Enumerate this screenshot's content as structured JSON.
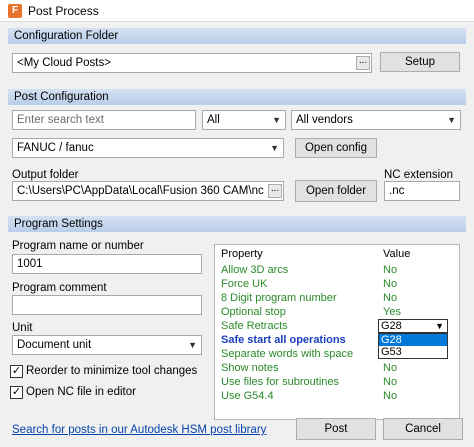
{
  "window": {
    "title": "Post Process"
  },
  "config_folder": {
    "section": "Configuration Folder",
    "value": "<My Cloud Posts>",
    "browse": "...",
    "setup": "Setup"
  },
  "post_config": {
    "section": "Post Configuration",
    "search_placeholder": "Enter search text",
    "filter_all": "All",
    "vendor": "All vendors",
    "post": "FANUC / fanuc",
    "open_config": "Open config",
    "output_folder_label": "Output folder",
    "output_folder": "C:\\Users\\PC\\AppData\\Local\\Fusion 360 CAM\\nc",
    "browse": "...",
    "open_folder": "Open folder",
    "nc_ext_label": "NC extension",
    "nc_ext": ".nc"
  },
  "program": {
    "section": "Program Settings",
    "name_label": "Program name or number",
    "name_value": "1001",
    "comment_label": "Program comment",
    "comment_value": "",
    "unit_label": "Unit",
    "unit_value": "Document unit",
    "reorder_label": "Reorder to minimize tool changes",
    "reorder_checked": "✓",
    "open_nc_label": "Open NC file in editor",
    "open_nc_checked": "✓"
  },
  "grid": {
    "header": {
      "property": "Property",
      "value": "Value"
    },
    "rows": [
      {
        "property": "Allow 3D arcs",
        "value": "No"
      },
      {
        "property": "Force UK",
        "value": "No"
      },
      {
        "property": "8 Digit program number",
        "value": "No"
      },
      {
        "property": "Optional stop",
        "value": "Yes"
      },
      {
        "property": "Safe Retracts",
        "value": "G28"
      },
      {
        "property": "Safe start all operations",
        "value": ""
      },
      {
        "property": "Separate words with space",
        "value": ""
      },
      {
        "property": "Show notes",
        "value": "No"
      },
      {
        "property": "Use files for subroutines",
        "value": "No"
      },
      {
        "property": "Use G54.4",
        "value": "No"
      },
      {
        "property": "",
        "value": ""
      }
    ],
    "dropdown": {
      "current": "G28",
      "options": [
        "G28",
        "G53"
      ]
    }
  },
  "footer": {
    "link": "Search for posts in our Autodesk HSM post library",
    "post": "Post",
    "cancel": "Cancel"
  }
}
